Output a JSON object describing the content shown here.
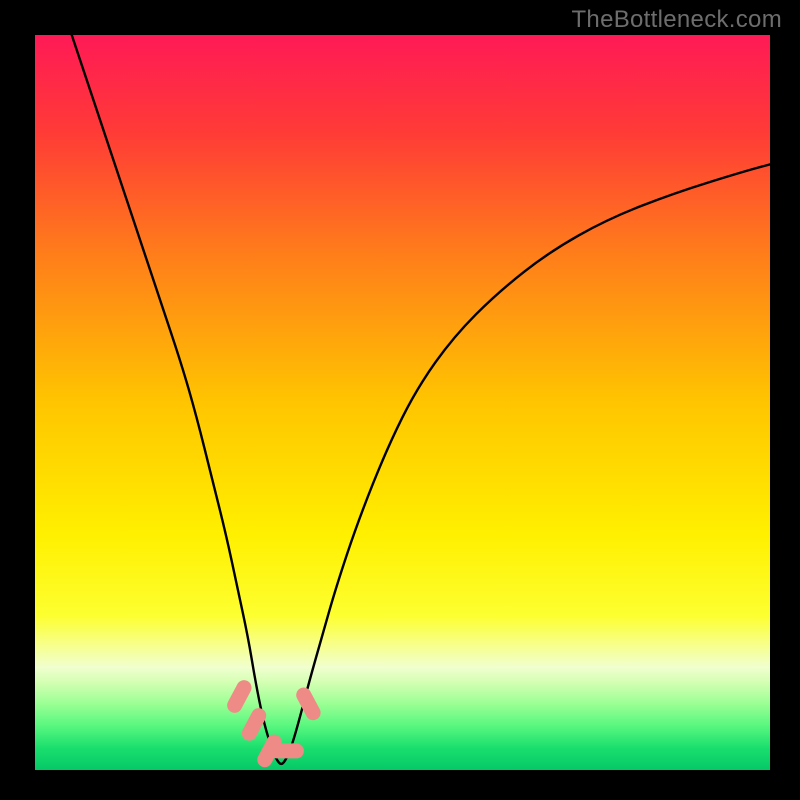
{
  "watermark": "TheBottleneck.com",
  "chart_data": {
    "type": "line",
    "title": "",
    "xlabel": "",
    "ylabel": "",
    "x_range": [
      0,
      100
    ],
    "y_range": [
      0,
      100
    ],
    "background_gradient_stops": [
      {
        "pct": 0.0,
        "color": "#ff1a56"
      },
      {
        "pct": 0.13,
        "color": "#ff3a37"
      },
      {
        "pct": 0.3,
        "color": "#ff7e1a"
      },
      {
        "pct": 0.5,
        "color": "#ffc500"
      },
      {
        "pct": 0.68,
        "color": "#fff000"
      },
      {
        "pct": 0.79,
        "color": "#fdff30"
      },
      {
        "pct": 0.83,
        "color": "#f7ff8c"
      },
      {
        "pct": 0.86,
        "color": "#f0ffcf"
      },
      {
        "pct": 0.88,
        "color": "#d5ffb4"
      },
      {
        "pct": 0.91,
        "color": "#9aff94"
      },
      {
        "pct": 0.94,
        "color": "#58f77f"
      },
      {
        "pct": 0.97,
        "color": "#1adf6e"
      },
      {
        "pct": 1.0,
        "color": "#05c867"
      }
    ],
    "series": [
      {
        "name": "bottleneck-curve",
        "stroke": "#000000",
        "x": [
          5,
          8,
          11,
          14,
          17,
          20,
          22,
          24,
          26,
          27.5,
          29,
          30,
          31,
          32,
          32.8,
          33.5,
          34.2,
          35,
          36,
          37.3,
          39,
          41,
          44,
          48,
          52,
          57,
          63,
          70,
          78,
          87,
          96,
          100
        ],
        "y": [
          100,
          91,
          82,
          73,
          64,
          55,
          48,
          40,
          32,
          25,
          18,
          12,
          7,
          3.5,
          1.5,
          0.6,
          1.5,
          3.5,
          7,
          12,
          18,
          25,
          34,
          44,
          52,
          59,
          65,
          70.5,
          75,
          78.5,
          81.3,
          82.4
        ]
      }
    ],
    "markers": [
      {
        "name": "pink-marker-a",
        "x": 27.8,
        "y": 10.0,
        "color": "#ef8b86"
      },
      {
        "name": "pink-marker-b",
        "x": 29.8,
        "y": 6.2,
        "color": "#ef8b86"
      },
      {
        "name": "pink-marker-c",
        "x": 31.9,
        "y": 2.6,
        "color": "#ef8b86"
      },
      {
        "name": "pink-marker-d",
        "x": 34.2,
        "y": 2.6,
        "color": "#ef8b86"
      },
      {
        "name": "pink-marker-e",
        "x": 37.2,
        "y": 9.0,
        "color": "#ef8b86"
      }
    ],
    "note": "Axes are unlabeled in the source image; x/y expressed as 0–100 percent of plot width/height with y=0 at bottom. Values are visual estimates."
  }
}
